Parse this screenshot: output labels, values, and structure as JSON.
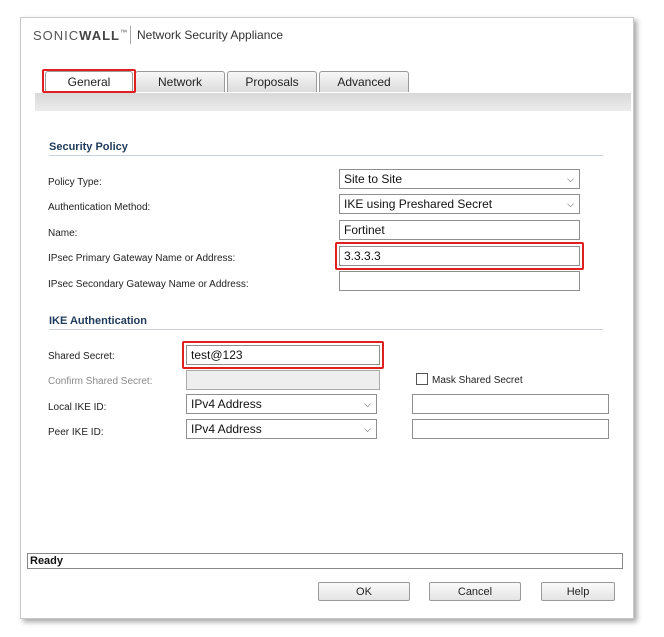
{
  "header": {
    "brand_thin": "SONIC",
    "brand_bold": "WALL",
    "trademark": "™",
    "app_title": "Network Security Appliance"
  },
  "tabs": [
    {
      "label": "General",
      "active": true
    },
    {
      "label": "Network",
      "active": false
    },
    {
      "label": "Proposals",
      "active": false
    },
    {
      "label": "Advanced",
      "active": false
    }
  ],
  "security_policy": {
    "title": "Security Policy",
    "policy_type": {
      "label": "Policy Type:",
      "value": "Site to Site"
    },
    "auth_method": {
      "label": "Authentication Method:",
      "value": "IKE using Preshared Secret"
    },
    "name": {
      "label": "Name:",
      "value": "Fortinet"
    },
    "primary_gateway": {
      "label": "IPsec Primary Gateway Name or Address:",
      "value": "3.3.3.3"
    },
    "secondary_gateway": {
      "label": "IPsec Secondary Gateway Name or Address:",
      "value": ""
    }
  },
  "ike_auth": {
    "title": "IKE Authentication",
    "shared_secret": {
      "label": "Shared Secret:",
      "value": "test@123"
    },
    "confirm_secret": {
      "label": "Confirm Shared Secret:",
      "value": ""
    },
    "mask_secret": {
      "label": "Mask Shared Secret",
      "checked": false
    },
    "local_ike_id": {
      "label": "Local IKE ID:",
      "type": "IPv4 Address",
      "value": ""
    },
    "peer_ike_id": {
      "label": "Peer IKE ID:",
      "type": "IPv4 Address",
      "value": ""
    }
  },
  "status": "Ready",
  "buttons": {
    "ok": "OK",
    "cancel": "Cancel",
    "help": "Help"
  },
  "icons": {
    "dropdown": "chevron-down-icon"
  },
  "colors": {
    "highlight": "#e02020",
    "section_title": "#1f3a5a"
  }
}
